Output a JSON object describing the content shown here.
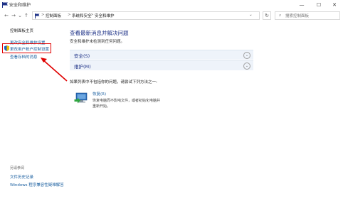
{
  "window": {
    "title": "安全和维护",
    "controls": {
      "minimize": "—",
      "maximize": "☐",
      "close": "✕"
    }
  },
  "nav": {
    "back": "←",
    "forward": "→",
    "dropdown": "⌄",
    "up": "↑",
    "breadcrumb": [
      "控制面板",
      "系统和安全",
      "安全和维护"
    ],
    "separator": ">",
    "address_dropdown": "⌄",
    "refresh": "↻"
  },
  "search": {
    "icon": "search-icon",
    "placeholder": "搜索控制面板"
  },
  "sidebar": {
    "home": "控制面板主页",
    "items": [
      "更改安全和维护设置",
      "更改用户帐户控制设置",
      "查看存档的消息"
    ],
    "see_also_title": "另请参阅",
    "see_also": [
      "文件历史记录",
      "Windows 程序兼容性疑难解答"
    ]
  },
  "main": {
    "title": "查看最新消息并解决问题",
    "subtitle": "安全和维护未检测到任何问题。",
    "sections": [
      {
        "label": "安全(S)",
        "expand_icon": "chevron-down-icon"
      },
      {
        "label": "维护(M)",
        "expand_icon": "chevron-down-icon"
      }
    ],
    "problem_prompt": "如果列表中不包括你的问题，请尝试下列方法之一:",
    "recovery": {
      "title": "恢复(R)",
      "description": "恢复电脑而不影响文件，或者初始化电脑并重新开始。"
    }
  },
  "colors": {
    "highlight": "#e00000",
    "link": "#1a5fa0",
    "heading": "#1e3287",
    "section_bg": "#eef3fa"
  }
}
